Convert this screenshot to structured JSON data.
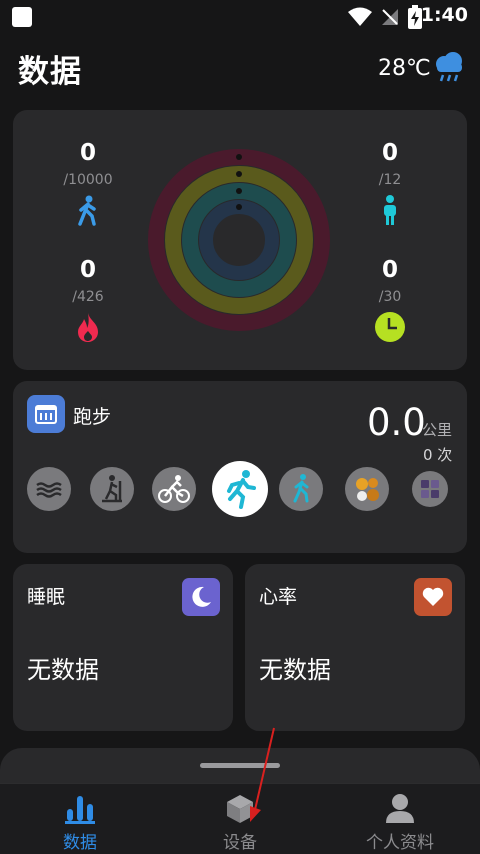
{
  "status_bar": {
    "time": "1:40"
  },
  "header": {
    "title": "数据",
    "temperature": "28℃",
    "weather_icon": "rain-cloud-icon"
  },
  "activity": {
    "steps": {
      "value": "0",
      "goal": "/10000",
      "icon": "walking-icon",
      "color": "#3b9be8"
    },
    "standing": {
      "value": "0",
      "goal": "/12",
      "icon": "standing-person-icon",
      "color": "#1fc9d8"
    },
    "calories": {
      "value": "0",
      "goal": "/426",
      "icon": "flame-icon",
      "color": "#f02a4f"
    },
    "exercise": {
      "value": "0",
      "goal": "/30",
      "icon": "clock-icon",
      "color": "#b6e022"
    },
    "ring_colors": [
      "#4a1a2c",
      "#5a5a1c",
      "#1e4c4e",
      "#24354a"
    ]
  },
  "sport": {
    "name": "跑步",
    "distance": "0.0",
    "unit": "公里",
    "count": "0 次",
    "types": [
      "swimming-icon",
      "climbing-icon",
      "cycling-icon",
      "running-icon",
      "walking-icon",
      "ball-sports-icon",
      "more-sports-icon"
    ],
    "selected_index": 3
  },
  "sleep": {
    "title": "睡眠",
    "value": "无数据"
  },
  "heart": {
    "title": "心率",
    "value": "无数据"
  },
  "bottom_nav": [
    {
      "label": "数据",
      "icon": "bar-chart-icon",
      "active": true
    },
    {
      "label": "设备",
      "icon": "device-cube-icon",
      "active": false
    },
    {
      "label": "个人资料",
      "icon": "profile-icon",
      "active": false
    }
  ]
}
